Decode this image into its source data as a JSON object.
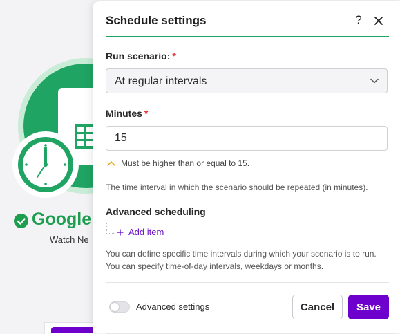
{
  "background": {
    "app_name": "Google",
    "app_subtitle": "Watch Ne"
  },
  "dialog": {
    "title": "Schedule settings",
    "help_glyph": "?",
    "run_scenario": {
      "label": "Run scenario:",
      "required_mark": "*",
      "selected": "At regular intervals"
    },
    "minutes": {
      "label": "Minutes",
      "required_mark": "*",
      "value": "15",
      "hint": "Must be higher than or equal to 15.",
      "help": "The time interval in which the scenario should be repeated (in minutes)."
    },
    "advanced_scheduling": {
      "label": "Advanced scheduling",
      "add_item": "Add item",
      "description": "You can define specific time intervals during which your scenario is to run. You can specify time-of-day intervals, weekdays or months."
    },
    "footer": {
      "advanced_settings_label": "Advanced settings",
      "advanced_settings_on": false,
      "cancel_label": "Cancel",
      "save_label": "Save"
    }
  },
  "colors": {
    "accent": "#6d00cc",
    "brand_green": "#1fa463",
    "required": "#e0242c"
  },
  "icons": [
    "help-icon",
    "close-icon",
    "chevron-down-icon",
    "chevron-up-icon",
    "plus-icon",
    "check-icon",
    "clock-icon",
    "spreadsheet-icon"
  ]
}
